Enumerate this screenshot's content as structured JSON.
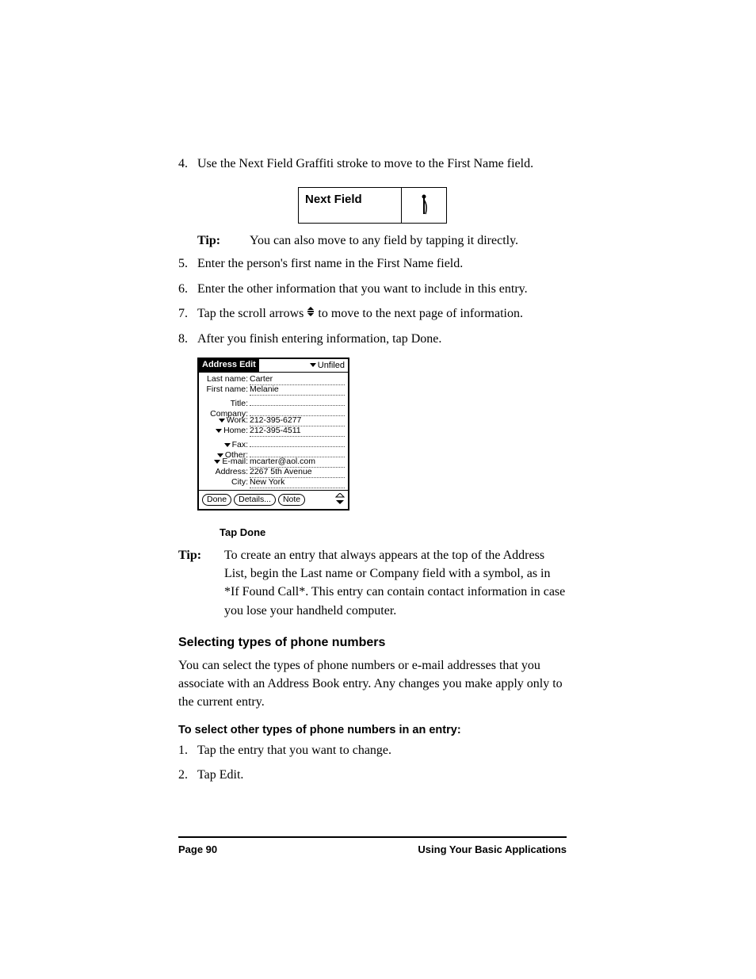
{
  "steps": {
    "s4": {
      "num": "4.",
      "text": "Use the Next Field Graffiti stroke to move to the First Name field."
    },
    "s5": {
      "num": "5.",
      "text": "Enter the person's first name in the First Name field."
    },
    "s6": {
      "num": "6.",
      "text": "Enter the other information that you want to include in this entry."
    },
    "s7": {
      "num": "7.",
      "pre": "Tap the scroll arrows ",
      "post": " to move to the next page of information."
    },
    "s8": {
      "num": "8.",
      "text": "After you finish entering information, tap Done."
    }
  },
  "nextFieldLabel": "Next Field",
  "tip1": {
    "label": "Tip:",
    "text": "You can also move to any field by tapping it directly."
  },
  "palm": {
    "title": "Address Edit",
    "category": "Unfiled",
    "rows": {
      "lastname": {
        "label": "Last name:",
        "value": "Carter"
      },
      "firstname": {
        "label": "First name:",
        "value": "Melanie"
      },
      "title": {
        "label": "Title:",
        "value": ""
      },
      "company": {
        "label": "Company:",
        "value": ""
      },
      "work": {
        "label": "Work:",
        "value": "212-395-6277",
        "drop": true
      },
      "home": {
        "label": "Home:",
        "value": "212-395-4511",
        "drop": true
      },
      "fax": {
        "label": "Fax:",
        "value": "",
        "drop": true
      },
      "other": {
        "label": "Other:",
        "value": "",
        "drop": true
      },
      "email": {
        "label": "E-mail:",
        "value": "mcarter@aol.com",
        "drop": true
      },
      "address": {
        "label": "Address:",
        "value": "2267 5th Avenue"
      },
      "city": {
        "label": "City:",
        "value": "New York"
      }
    },
    "buttons": {
      "done": "Done",
      "details": "Details...",
      "note": "Note"
    }
  },
  "tapDoneCaption": "Tap Done",
  "tip2": {
    "label": "Tip:",
    "text": "To create an entry that always appears at the top of the Address List, begin the Last name or Company field with a symbol, as in *If Found Call*. This entry can contain contact information in case you lose your handheld computer."
  },
  "section": {
    "heading": "Selecting types of phone numbers",
    "para": "You can select the types of phone numbers or e-mail addresses that you associate with an Address Book entry. Any changes you make apply only to the current entry."
  },
  "subheading": "To select other types of phone numbers in an entry:",
  "steps2": {
    "s1": {
      "num": "1.",
      "text": "Tap the entry that you want to change."
    },
    "s2": {
      "num": "2.",
      "text": "Tap Edit."
    }
  },
  "footer": {
    "left": "Page 90",
    "right": "Using Your Basic Applications"
  }
}
